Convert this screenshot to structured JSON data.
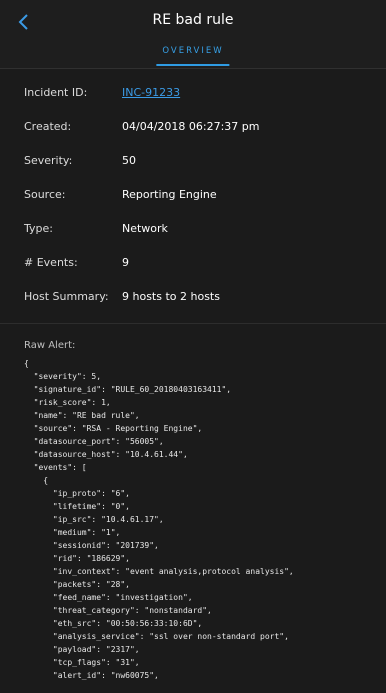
{
  "header": {
    "title": "RE bad rule",
    "tab": "OVERVIEW"
  },
  "details": [
    {
      "label": "Incident ID:",
      "value": "INC-91233"
    },
    {
      "label": "Created:",
      "value": "04/04/2018 06:27:37 pm"
    },
    {
      "label": "Severity:",
      "value": "50"
    },
    {
      "label": "Source:",
      "value": "Reporting Engine"
    },
    {
      "label": "Type:",
      "value": "Network"
    },
    {
      "label": "# Events:",
      "value": "9"
    },
    {
      "label": "Host Summary:",
      "value": "9 hosts to 2 hosts"
    }
  ],
  "raw": {
    "label": "Raw Alert:",
    "lines": [
      "{",
      "  \"severity\": 5,",
      "  \"signature_id\": \"RULE_60_20180403163411\",",
      "  \"risk_score\": 1,",
      "  \"name\": \"RE bad rule\",",
      "  \"source\": \"RSA - Reporting Engine\",",
      "  \"datasource_port\": \"56005\",",
      "  \"datasource_host\": \"10.4.61.44\",",
      "  \"events\": [",
      "    {",
      "      \"ip_proto\": \"6\",",
      "      \"lifetime\": \"0\",",
      "      \"ip_src\": \"10.4.61.17\",",
      "      \"medium\": \"1\",",
      "      \"sessionid\": \"201739\",",
      "      \"rid\": \"186629\",",
      "      \"inv_context\": \"event analysis,protocol analysis\",",
      "      \"packets\": \"28\",",
      "      \"feed_name\": \"investigation\",",
      "      \"threat_category\": \"nonstandard\",",
      "      \"eth_src\": \"00:50:56:33:10:6D\",",
      "      \"analysis_service\": \"ssl over non-standard port\",",
      "      \"payload\": \"2317\",",
      "      \"tcp_flags\": \"31\",",
      "      \"alert_id\": \"nw60075\","
    ]
  },
  "colors": {
    "accent": "#2f9be3",
    "background": "#1b1b1b"
  }
}
